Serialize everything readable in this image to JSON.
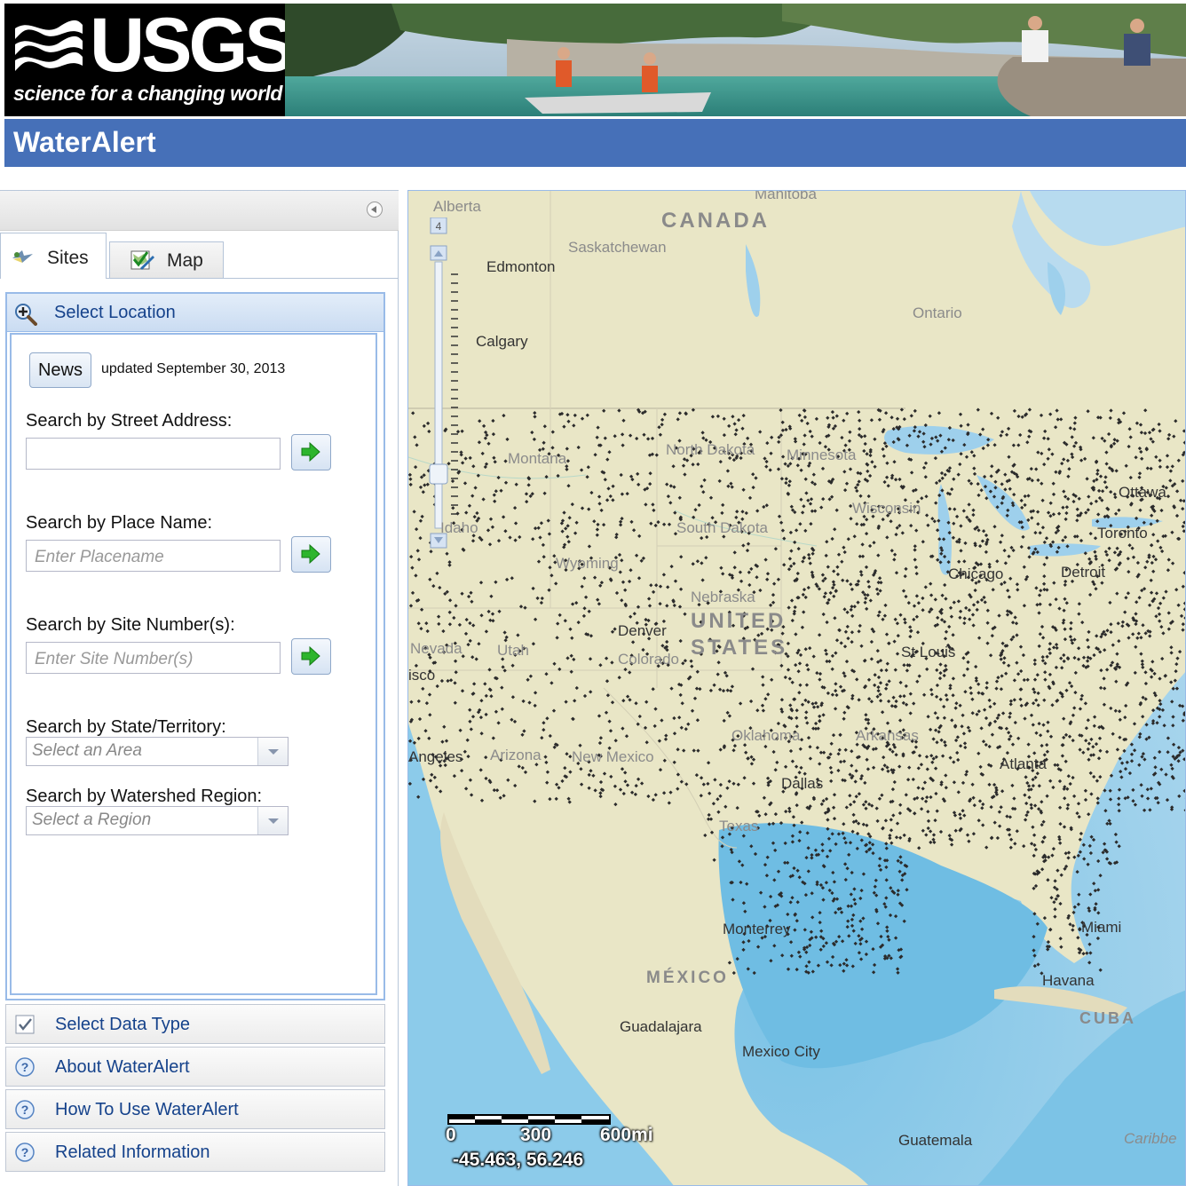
{
  "header": {
    "logo_text": "USGS",
    "tagline": "science for a changing world",
    "app_title": "WaterAlert"
  },
  "tabs": [
    {
      "label": "Sites"
    },
    {
      "label": "Map"
    }
  ],
  "location_panel": {
    "title": "Select Location",
    "news_button": "News",
    "news_updated": "updated September 30, 2013",
    "street": {
      "label": "Search by Street Address:",
      "value": "",
      "placeholder": ""
    },
    "place": {
      "label": "Search by Place Name:",
      "placeholder": "Enter Placename"
    },
    "site": {
      "label": "Search by Site Number(s):",
      "placeholder": "Enter Site Number(s)"
    },
    "state": {
      "label": "Search by State/Territory:",
      "placeholder": "Select an Area"
    },
    "watershed": {
      "label": "Search by Watershed Region:",
      "placeholder": "Select a Region"
    }
  },
  "accordion": [
    {
      "label": "Select Data Type",
      "icon": "checkbox-icon"
    },
    {
      "label": "About WaterAlert",
      "icon": "help-icon"
    },
    {
      "label": "How To Use WaterAlert",
      "icon": "help-icon"
    },
    {
      "label": "Related Information",
      "icon": "help-icon"
    }
  ],
  "map": {
    "zoom_level": "4",
    "scale": [
      "0",
      "300",
      "600mi"
    ],
    "coordinates": "-45.463, 56.246",
    "labels": {
      "countries": [
        "CANADA",
        "UNITED STATES",
        "MÉXICO",
        "CUBA"
      ],
      "regions": [
        "Alberta",
        "Manitoba",
        "Saskatchewan",
        "Ontario",
        "Montana",
        "North Dakota",
        "Minnesota",
        "South Dakota",
        "Wisconsin",
        "Wyoming",
        "Idaho",
        "Nebraska",
        "Nevada",
        "Utah",
        "Colorado",
        "Arizona",
        "New Mexico",
        "Oklahoma",
        "Arkansas",
        "Texas",
        "Caribbe"
      ],
      "cities": [
        "Edmonton",
        "Calgary",
        "Ottawa",
        "Toronto",
        "Detroit",
        "Chicago",
        "Denver",
        "St Louis",
        "Dallas",
        "Atlanta",
        "Miami",
        "Havana",
        "Monterrey",
        "Guadalajara",
        "Mexico City",
        "Guatemala",
        "Angeles",
        "isco"
      ]
    }
  }
}
